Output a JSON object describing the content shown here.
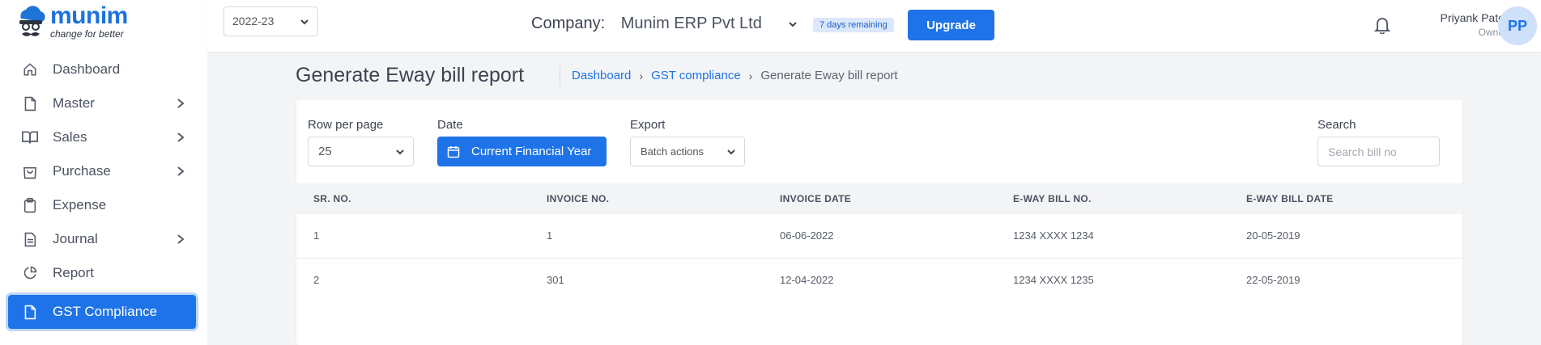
{
  "brand": {
    "name": "munim",
    "tagline": "change for better"
  },
  "sidebar": {
    "items": [
      {
        "label": "Dashboard",
        "icon": "home-icon",
        "has_submenu": false
      },
      {
        "label": "Master",
        "icon": "file-icon",
        "has_submenu": true
      },
      {
        "label": "Sales",
        "icon": "book-icon",
        "has_submenu": true
      },
      {
        "label": "Purchase",
        "icon": "shopping-bag-icon",
        "has_submenu": true
      },
      {
        "label": "Expense",
        "icon": "clipboard-icon",
        "has_submenu": false
      },
      {
        "label": "Journal",
        "icon": "document-icon",
        "has_submenu": true
      },
      {
        "label": "Report",
        "icon": "pie-chart-icon",
        "has_submenu": false
      },
      {
        "label": "GST Compliance",
        "icon": "file-icon",
        "has_submenu": false,
        "active": true
      }
    ]
  },
  "header": {
    "financial_year": "2022-23",
    "company_label": "Company:",
    "company_name": "Munim ERP Pvt Ltd",
    "trial_badge": "7 days remaining",
    "upgrade_label": "Upgrade",
    "user_name": "Priyank Patel",
    "user_role": "Owner",
    "user_initials": "PP"
  },
  "page": {
    "title": "Generate Eway bill report",
    "breadcrumb": [
      "Dashboard",
      "GST compliance",
      "Generate Eway bill report"
    ]
  },
  "controls": {
    "rows_label": "Row per page",
    "rows_value": "25",
    "date_label": "Date",
    "date_value": "Current Financial Year",
    "export_label": "Export",
    "export_value": "Batch actions",
    "search_label": "Search",
    "search_placeholder": "Search bill no"
  },
  "table": {
    "columns": [
      "SR. NO.",
      "INVOICE NO.",
      "INVOICE DATE",
      "E-WAY BILL NO.",
      "E-WAY BILL DATE"
    ],
    "rows": [
      [
        "1",
        "1",
        "06-06-2022",
        "1234 XXXX 1234",
        "20-05-2019"
      ],
      [
        "2",
        "301",
        "12-04-2022",
        "1234 XXXX 1235",
        "22-05-2019"
      ]
    ]
  },
  "colors": {
    "accent": "#1e73e8",
    "sidebar_active": "#1e73e8",
    "page_bg": "#f3f4f6"
  }
}
